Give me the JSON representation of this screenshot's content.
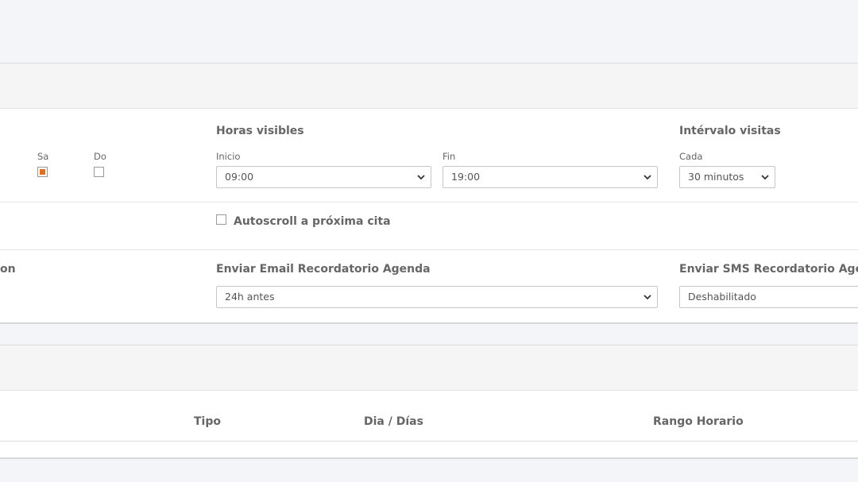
{
  "days": {
    "sa": {
      "label": "Sa",
      "checked": true
    },
    "do": {
      "label": "Do",
      "checked": false
    }
  },
  "horas_visibles": {
    "title": "Horas visibles",
    "inicio": {
      "label": "Inicio",
      "value": "09:00"
    },
    "fin": {
      "label": "Fin",
      "value": "19:00"
    }
  },
  "intervalo": {
    "title": "Intérvalo visitas",
    "cada": {
      "label": "Cada",
      "value": "30 minutos"
    }
  },
  "autoscroll": {
    "label": "Autoscroll a próxima cita",
    "checked": false
  },
  "recordatorios": {
    "left_fragment": "on",
    "email": {
      "title": "Enviar Email Recordatorio Agenda",
      "value": "24h antes"
    },
    "sms": {
      "title": "Enviar SMS Recordatorio Agenda",
      "value": "Deshabilitado"
    }
  },
  "table": {
    "columns": [
      "Tipo",
      "Dia / Días",
      "Rango Horario"
    ]
  },
  "colors": {
    "accent": "#e0701c",
    "card_header": "#f5f5f5",
    "page_bg": "#f4f5f8"
  }
}
